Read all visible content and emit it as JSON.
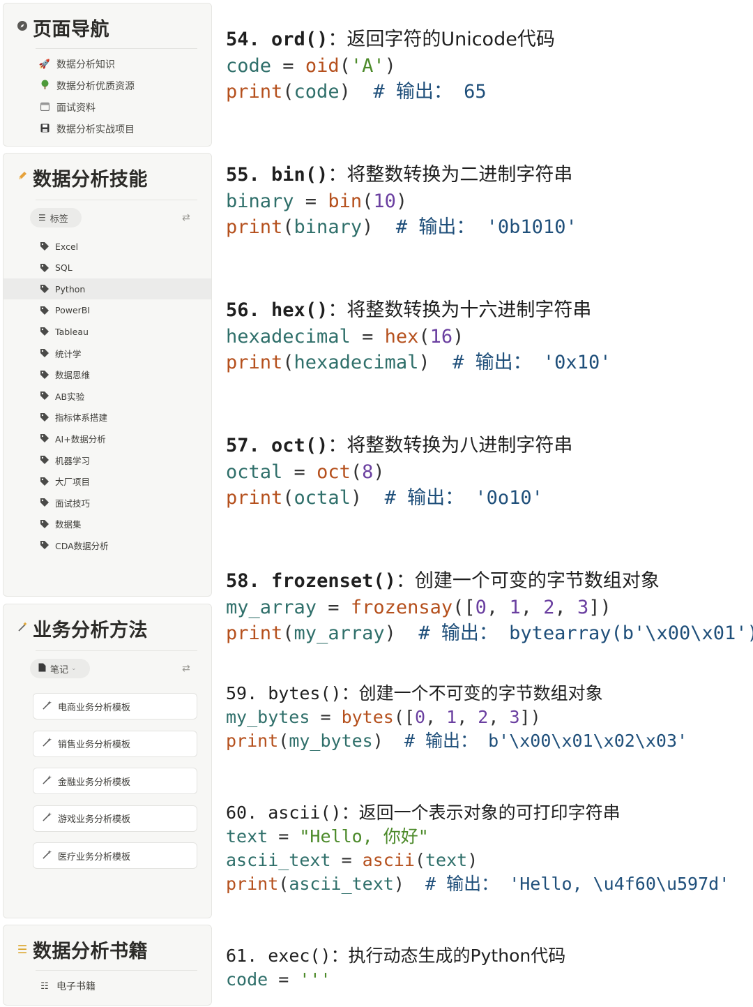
{
  "sidebar": {
    "nav": {
      "title": "页面导航",
      "icon": "compass-icon",
      "items": [
        {
          "label": "数据分析知识",
          "icon": "rocket-icon"
        },
        {
          "label": "数据分析优质资源",
          "icon": "tree-icon"
        },
        {
          "label": "面试资料",
          "icon": "calendar-icon"
        },
        {
          "label": "数据分析实战项目",
          "icon": "floppy-icon"
        }
      ]
    },
    "skills": {
      "title": "数据分析技能",
      "icon": "pencil-icon",
      "view_pill": "标签",
      "tags": [
        "Excel",
        "SQL",
        "Python",
        "PowerBI",
        "Tableau",
        "统计学",
        "数据思维",
        "AB实验",
        "指标体系搭建",
        "AI+数据分析",
        "机器学习",
        "大厂项目",
        "面试技巧",
        "数据集",
        "CDA数据分析"
      ],
      "active_tag": "Python"
    },
    "methods": {
      "title": "业务分析方法",
      "icon": "magic-wand-icon",
      "view_pill": "笔记",
      "templates": [
        "电商业务分析模板",
        "销售业务分析模板",
        "金融业务分析模板",
        "游戏业务分析模板",
        "医疗业务分析模板"
      ]
    },
    "books": {
      "title": "数据分析书籍",
      "icon": "checklist-icon",
      "items": [
        {
          "label": "电子书籍",
          "icon": "checklist-icon"
        }
      ]
    }
  },
  "code": {
    "b54": {
      "num": "54.",
      "fn": "ord()",
      "colon": "：",
      "desc": "返回字符的Unicode代码",
      "l1_var": "code",
      "l1_fn": "oid",
      "l1_arg": "'A'",
      "l2_arg": "code",
      "l2_comment": "# 输出：",
      "l2_out": "65"
    },
    "b55": {
      "num": "55.",
      "fn": "bin()",
      "colon": "：",
      "desc": "将整数转换为二进制字符串",
      "l1_var": "binary",
      "l1_fn": "bin",
      "l1_arg": "10",
      "l2_arg": "binary",
      "l2_comment": "# 输出：",
      "l2_out": "'0b1010'"
    },
    "b56": {
      "num": "56.",
      "fn": "hex()",
      "colon": "：",
      "desc": "将整数转换为十六进制字符串",
      "l1_var": "hexadecimal",
      "l1_fn": "hex",
      "l1_arg": "16",
      "l2_arg": "hexadecimal",
      "l2_comment": "# 输出：",
      "l2_out": "'0x10'"
    },
    "b57": {
      "num": "57.",
      "fn": "oct()",
      "colon": "：",
      "desc": "将整数转换为八进制字符串",
      "l1_var": "octal",
      "l1_fn": "oct",
      "l1_arg": "8",
      "l2_arg": "octal",
      "l2_comment": "# 输出：",
      "l2_out": "'0o10'"
    },
    "b58": {
      "num": "58.",
      "fn": "frozenset()",
      "colon": "：",
      "desc": "创建一个可变的字节数组对象",
      "l1_var": "my_array",
      "l1_fn": "frozensay",
      "l1_list": [
        "0",
        "1",
        "2",
        "3"
      ],
      "l2_arg": "my_array",
      "l2_comment": "# 输出：",
      "l2_out": "bytearray(b'\\x00\\x01')"
    },
    "b59": {
      "num": "59.",
      "fn": "bytes()",
      "colon": "：",
      "desc": "创建一个不可变的字节数组对象",
      "l1_var": "my_bytes",
      "l1_fn": "bytes",
      "l1_list": [
        "0",
        "1",
        "2",
        "3"
      ],
      "l2_arg": "my_bytes",
      "l2_comment": "# 输出：",
      "l2_out": "b'\\x00\\x01\\x02\\x03'"
    },
    "b60": {
      "num": "60.",
      "fn": "ascii()",
      "colon": "：",
      "desc": "返回一个表示对象的可打印字符串",
      "l1_var": "text",
      "l1_str": "\"Hello, 你好\"",
      "l2_var": "ascii_text",
      "l2_fn": "ascii",
      "l2_arg": "text",
      "l3_arg": "ascii_text",
      "l3_comment": "# 输出：",
      "l3_out": "'Hello, \\u4f60\\u597d'"
    },
    "b61": {
      "num": "61.",
      "fn": "exec()",
      "colon": "：",
      "desc": "执行动态生成的Python代码",
      "l1_var": "code",
      "l1_str": "'''"
    },
    "print_kw": "print",
    "eq": " = "
  }
}
